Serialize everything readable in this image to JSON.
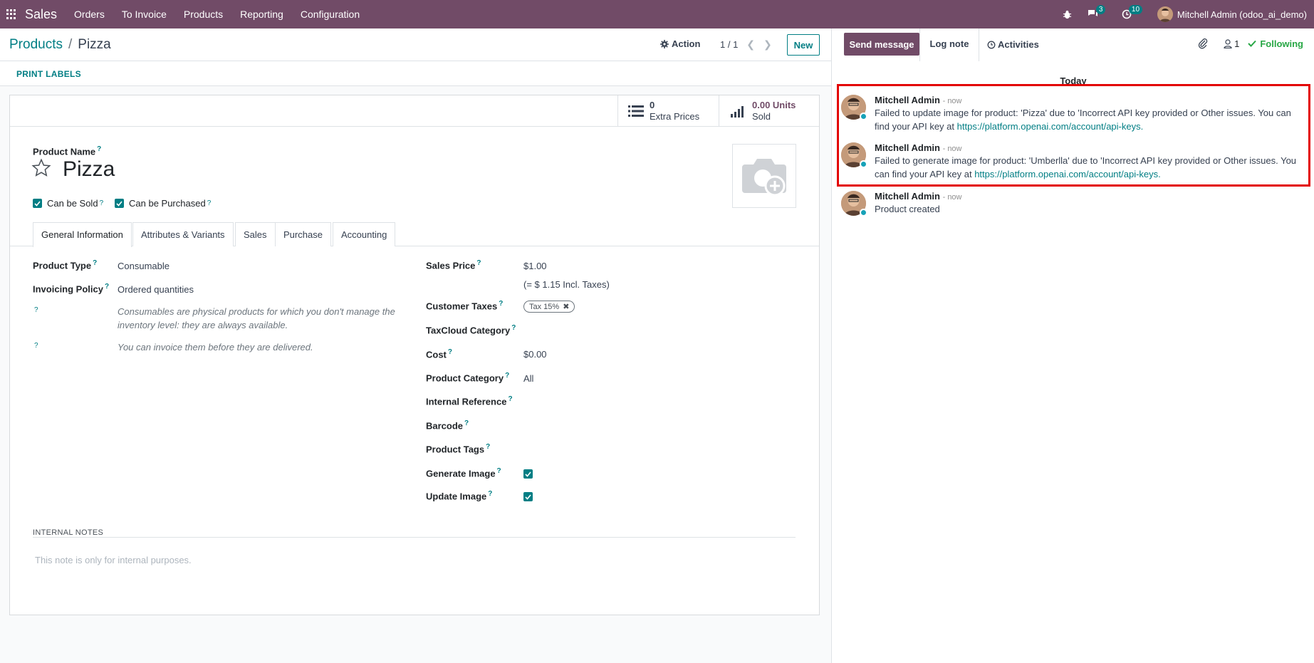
{
  "navbar": {
    "app_name": "Sales",
    "menu": [
      "Orders",
      "To Invoice",
      "Products",
      "Reporting",
      "Configuration"
    ],
    "messages_badge": "3",
    "activities_badge": "10",
    "user": "Mitchell Admin (odoo_ai_demo)"
  },
  "control": {
    "breadcrumb_parent": "Products",
    "breadcrumb_current": "Pizza",
    "action_label": "Action",
    "pager": "1 / 1",
    "new_label": "New",
    "print_labels": "PRINT LABELS"
  },
  "stats": {
    "extra_prices_value": "0",
    "extra_prices_label": "Extra Prices",
    "units_sold_value": "0.00 Units",
    "units_sold_label": "Sold"
  },
  "form": {
    "product_name_label": "Product Name",
    "product_name": "Pizza",
    "can_be_sold": "Can be Sold",
    "can_be_purchased": "Can be Purchased",
    "tabs": [
      "General Information",
      "Attributes & Variants",
      "Sales",
      "Purchase",
      "Accounting"
    ],
    "left": {
      "product_type_label": "Product Type",
      "product_type": "Consumable",
      "invoicing_policy_label": "Invoicing Policy",
      "invoicing_policy": "Ordered quantities",
      "hint1": "Consumables are physical products for which you don't manage the inventory level: they are always available.",
      "hint2": "You can invoice them before they are delivered."
    },
    "right": {
      "sales_price_label": "Sales Price",
      "sales_price": "$1.00",
      "incl_taxes": "(= $ 1.15 Incl. Taxes)",
      "customer_taxes_label": "Customer Taxes",
      "tax_tag": "Tax 15%",
      "taxcloud_label": "TaxCloud Category",
      "cost_label": "Cost",
      "cost": "$0.00",
      "category_label": "Product Category",
      "category": "All",
      "internal_ref_label": "Internal Reference",
      "barcode_label": "Barcode",
      "tags_label": "Product Tags",
      "generate_image_label": "Generate Image",
      "update_image_label": "Update Image"
    },
    "notes_title": "INTERNAL NOTES",
    "notes_placeholder": "This note is only for internal purposes."
  },
  "chatter": {
    "send_message": "Send message",
    "log_note": "Log note",
    "activities": "Activities",
    "followers_count": "1",
    "following": "Following",
    "today": "Today",
    "messages": [
      {
        "author": "Mitchell Admin",
        "time": "- now",
        "text": "Failed to update image for product: 'Pizza' due to 'Incorrect API key provided or Other issues. You can find your API key at",
        "link": "https://platform.openai.com/account/api-keys."
      },
      {
        "author": "Mitchell Admin",
        "time": "- now",
        "text": "Failed to generate image for product: 'Umberlla' due to 'Incorrect API key provided or Other issues. You can find your API key at",
        "link": "https://platform.openai.com/account/api-keys."
      },
      {
        "author": "Mitchell Admin",
        "time": "- now",
        "text": "Product created",
        "link": ""
      }
    ]
  },
  "colors": {
    "brand": "#714B67",
    "accent": "#017e84",
    "highlight": "#e30000",
    "following": "#28a745"
  }
}
